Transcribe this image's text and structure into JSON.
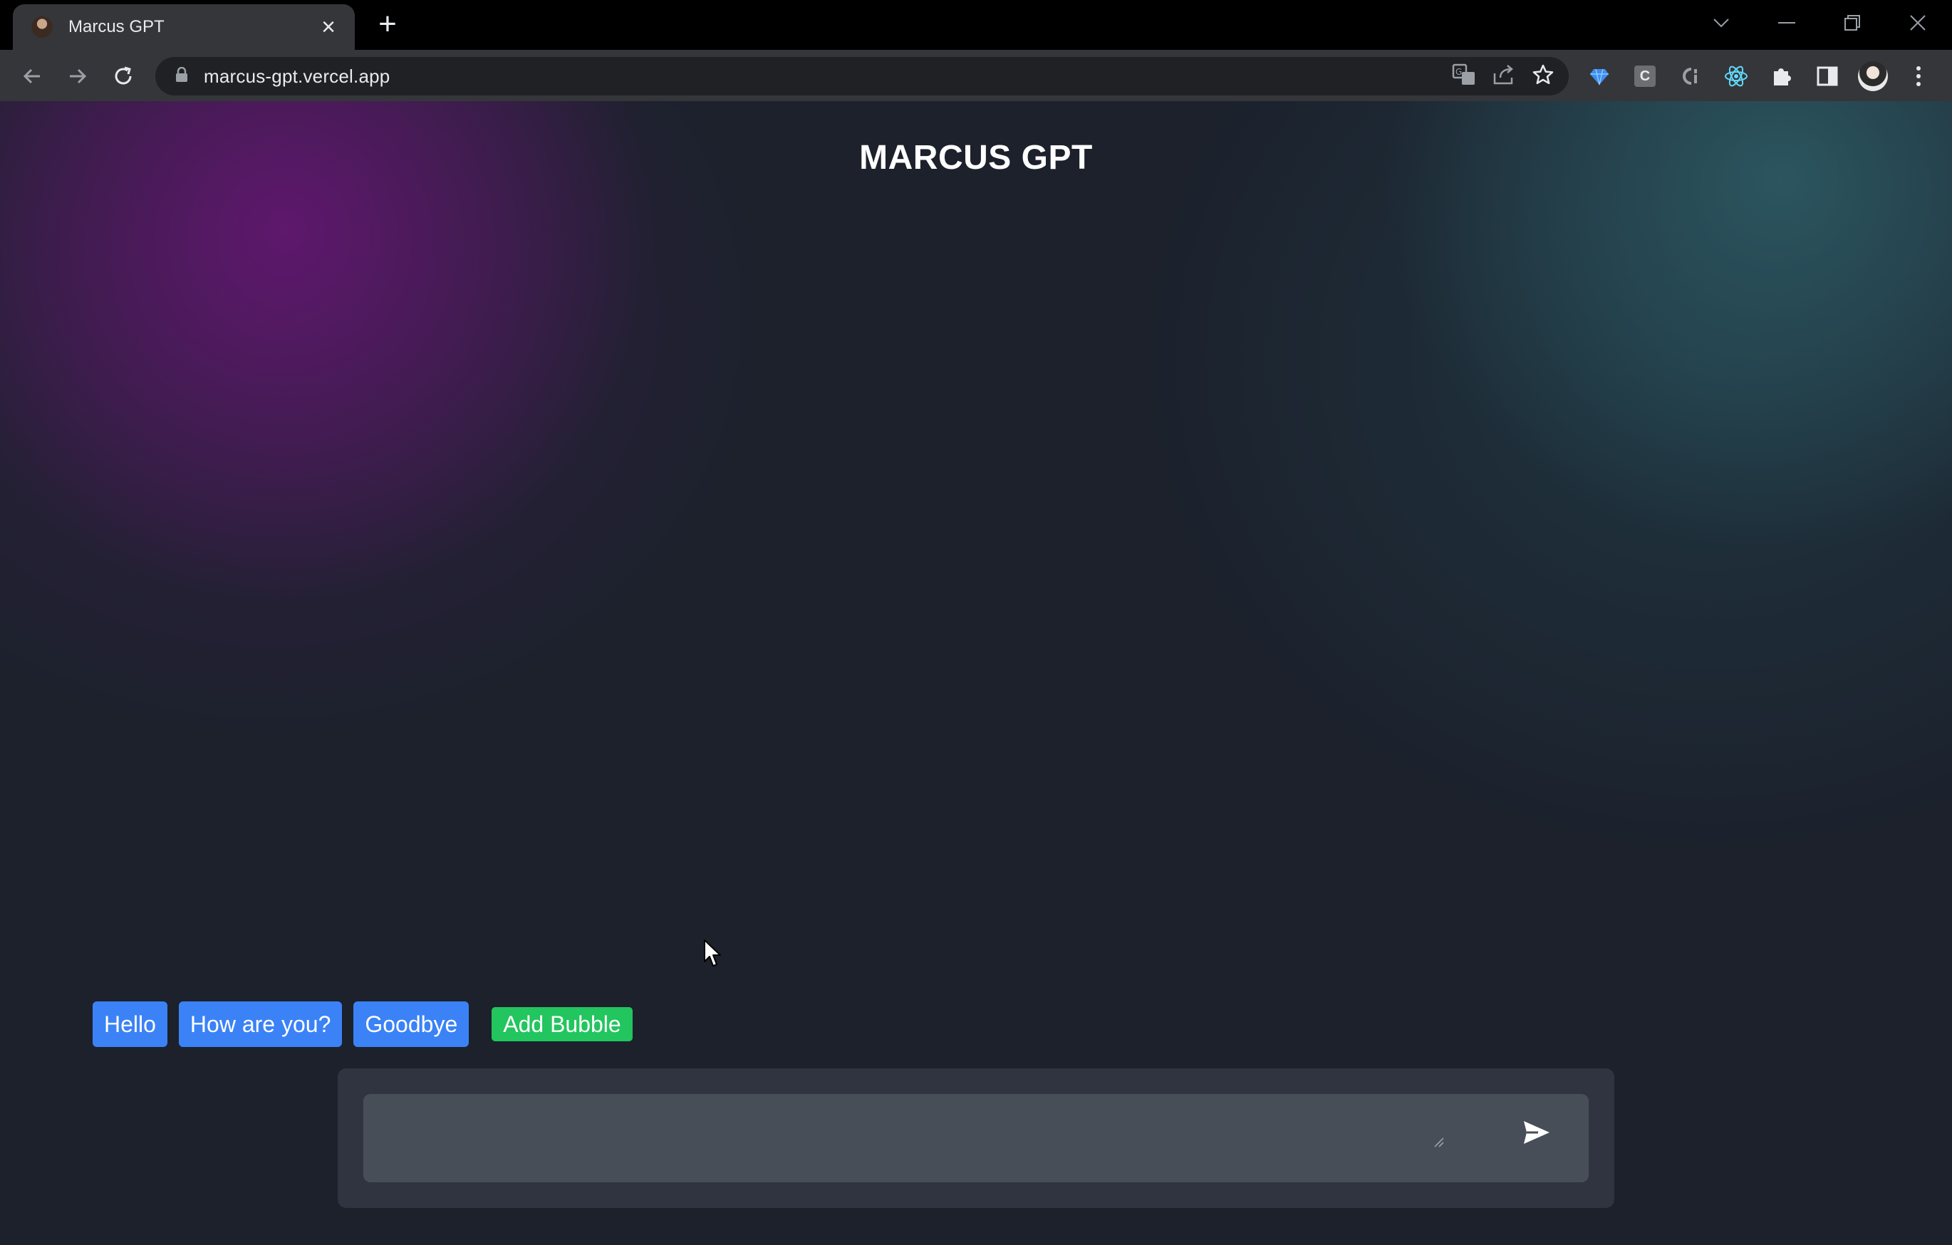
{
  "browser": {
    "tab": {
      "title": "Marcus GPT",
      "close_icon": "close-icon",
      "favicon": "marcus-avatar-favicon"
    },
    "new_tab_icon": "plus-icon",
    "url": "marcus-gpt.vercel.app",
    "nav": {
      "back": "arrow-left-icon",
      "forward": "arrow-right-icon",
      "reload": "reload-icon"
    },
    "omnibox_icons": [
      "lock-icon",
      "translate-icon",
      "share-icon",
      "star-icon"
    ],
    "extensions": [
      "gem-extension-icon",
      "c-extension-icon",
      "ci-extension-icon",
      "react-extension-icon",
      "puzzle-icon",
      "side-panel-icon",
      "profile-avatar",
      "kebab-menu-icon"
    ],
    "c_extension_label": "C",
    "window_controls": [
      "chevron-down-icon",
      "minimize-icon",
      "restore-icon",
      "close-window-icon"
    ]
  },
  "page": {
    "title": "MARCUS GPT",
    "quick_replies": [
      "Hello",
      "How are you?",
      "Goodbye"
    ],
    "add_bubble_label": "Add Bubble",
    "composer": {
      "value": "",
      "placeholder": "",
      "send_icon": "send-icon"
    }
  },
  "colors": {
    "quick_reply_bg": "#3b82f6",
    "add_bubble_bg": "#22c55e",
    "page_bg": "#1c212c",
    "composer_bg": "#2f3440",
    "input_bg": "#474e57"
  }
}
